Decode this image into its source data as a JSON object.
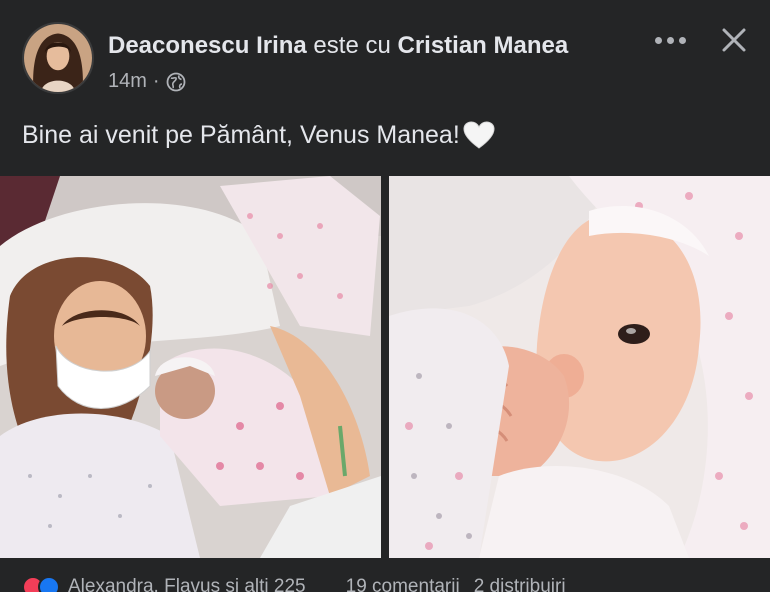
{
  "post": {
    "author": "Deaconescu Irina",
    "with_text": "este cu",
    "tagged": "Cristian Manea",
    "time": "14m",
    "separator": "·",
    "privacy_icon": "globe-icon",
    "caption": "Bine ai venit pe Pământ, Venus Manea!",
    "caption_emoji": "white-heart-icon"
  },
  "header_actions": {
    "more_icon": "more-horizontal-icon",
    "close_icon": "close-icon"
  },
  "photos": [
    {
      "name": "mother-with-newborn-photo"
    },
    {
      "name": "newborn-closeup-photo"
    }
  ],
  "footer": {
    "reaction_icons": [
      "love",
      "like"
    ],
    "reactors": "Alexandra, Flavus și alți 225",
    "comments": "19 comentarii",
    "shares": "2 distribuiri"
  },
  "colors": {
    "background": "#242526",
    "text_primary": "#e4e6eb",
    "text_secondary": "#b0b3b8"
  }
}
